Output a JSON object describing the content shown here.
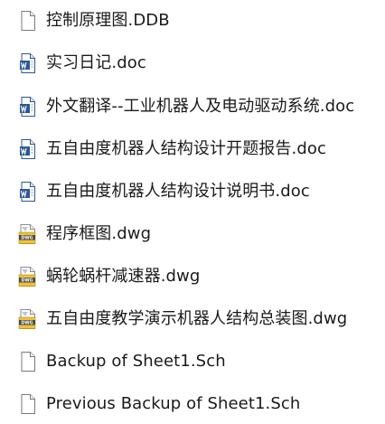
{
  "files": [
    {
      "name": "控制原理图.DDB",
      "icon": "blank-file-icon"
    },
    {
      "name": "实习日记.doc",
      "icon": "word-document-icon"
    },
    {
      "name": "外文翻译--工业机器人及电动驱动系统.doc",
      "icon": "word-document-icon"
    },
    {
      "name": "五自由度机器人结构设计开题报告.doc",
      "icon": "word-document-icon"
    },
    {
      "name": "五自由度机器人结构设计说明书.doc",
      "icon": "word-document-icon"
    },
    {
      "name": "程序框图.dwg",
      "icon": "dwg-drawing-icon"
    },
    {
      "name": "蜗轮蜗杆减速器.dwg",
      "icon": "dwg-drawing-icon"
    },
    {
      "name": "五自由度教学演示机器人结构总装图.dwg",
      "icon": "dwg-drawing-icon"
    },
    {
      "name": "Backup of Sheet1.Sch",
      "icon": "blank-file-icon"
    },
    {
      "name": "Previous Backup of Sheet1.Sch",
      "icon": "blank-file-icon"
    }
  ],
  "colors": {
    "word_blue": "#2b5797",
    "dwg_yellow": "#f2c230",
    "dwg_dark": "#4a4a4a",
    "outline": "#7a7a7a"
  }
}
